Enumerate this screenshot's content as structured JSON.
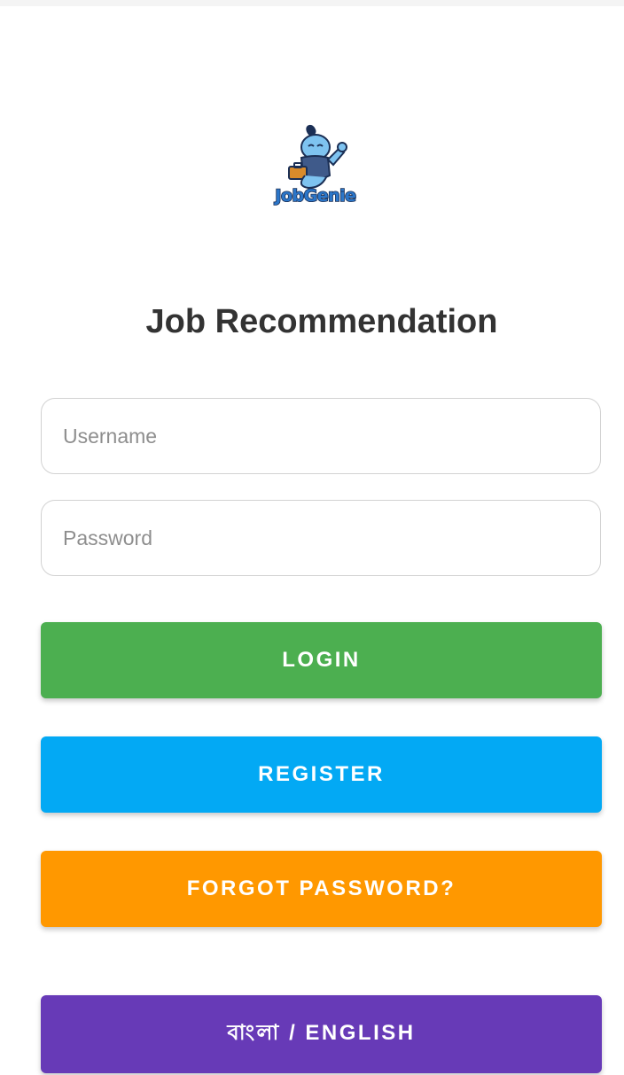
{
  "logo": {
    "text": "JobGenie",
    "icon": "genie-mascot-icon"
  },
  "title": "Job Recommendation",
  "form": {
    "username_placeholder": "Username",
    "password_placeholder": "Password",
    "username_value": "",
    "password_value": ""
  },
  "buttons": {
    "login": "LOGIN",
    "register": "REGISTER",
    "forgot_password": "FORGOT PASSWORD?",
    "language": "বাংলা / ENGLISH"
  },
  "colors": {
    "login": "#4caf50",
    "register": "#03a9f4",
    "forgot_password": "#ff9800",
    "language": "#673ab7",
    "title": "#333333"
  }
}
